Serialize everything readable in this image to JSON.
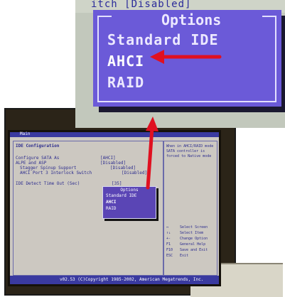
{
  "zoom": {
    "top_text": "itch [Disabled]",
    "popup_title": "Options",
    "items": [
      "Standard IDE",
      "AHCI",
      "RAID"
    ],
    "selected": "AHCI"
  },
  "bios": {
    "topbar_label": "Main",
    "section_title": "IDE Configuration",
    "rows": [
      {
        "label": "Configure SATA As",
        "value": "[AHCI]"
      },
      {
        "label": "ALPE and ASP",
        "value": "[Disabled]"
      },
      {
        "label": "Stagger Spinup Support",
        "value": "[Disabled]"
      },
      {
        "label": "AHCI Port 3 Interlock Switch",
        "value": "[Disabled]"
      },
      {
        "label": "IDE Detect Time Out (Sec)",
        "value": "[35]"
      }
    ],
    "help_text": [
      "When in AHCI/RAID mode",
      "SATA controller is",
      "forced to Native mode"
    ],
    "keys": [
      {
        "key": "↔",
        "desc": "Select Screen"
      },
      {
        "key": "↑↓",
        "desc": "Select Item"
      },
      {
        "key": "+-",
        "desc": "Change Option"
      },
      {
        "key": "F1",
        "desc": "General Help"
      },
      {
        "key": "F10",
        "desc": "Save and Exit"
      },
      {
        "key": "ESC",
        "desc": "Exit"
      }
    ],
    "footer": "v02.53 (C)Copyright 1985-2002, American Megatrends, Inc.",
    "popup_title": "Options",
    "popup_items": [
      "Standard IDE",
      "AHCI",
      "RAID"
    ]
  },
  "colors": {
    "accent": "#e01020",
    "popup": "#6b5ad8",
    "bios_bg": "#ccc8c1"
  }
}
